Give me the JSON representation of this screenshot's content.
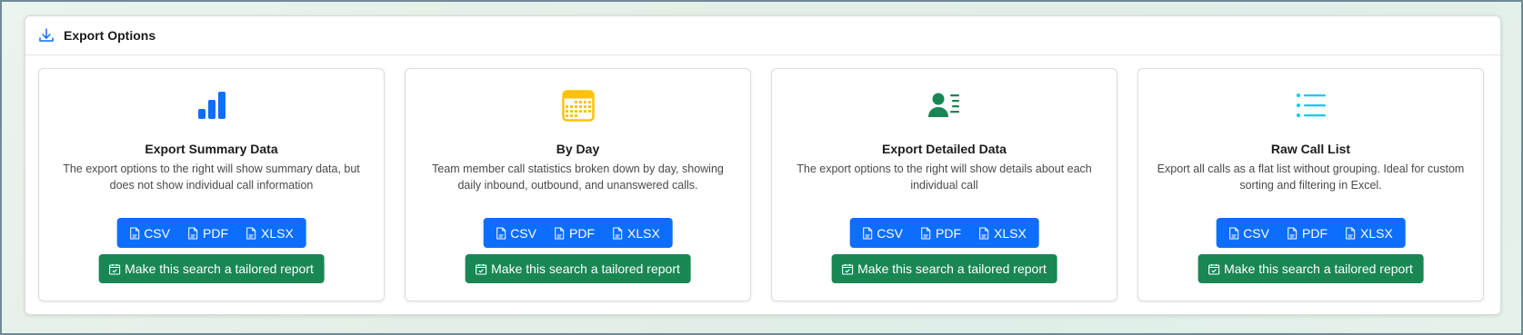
{
  "panel": {
    "title": "Export Options",
    "icon": "download-icon"
  },
  "cards": [
    {
      "icon": "bar-chart-icon",
      "icon_color": "#0d6efd",
      "title": "Export Summary Data",
      "description": "The export options to the right will show summary data, but does not show individual call information",
      "buttons": {
        "csv": "CSV",
        "pdf": "PDF",
        "xlsx": "XLSX"
      },
      "report_label": "Make this search a tailored report"
    },
    {
      "icon": "calendar-icon",
      "icon_color": "#ffc107",
      "title": "By Day",
      "description": "Team member call statistics broken down by day, showing daily inbound, outbound, and unanswered calls.",
      "buttons": {
        "csv": "CSV",
        "pdf": "PDF",
        "xlsx": "XLSX"
      },
      "report_label": "Make this search a tailored report"
    },
    {
      "icon": "person-lines-icon",
      "icon_color": "#198754",
      "title": "Export Detailed Data",
      "description": "The export options to the right will show details about each individual call",
      "buttons": {
        "csv": "CSV",
        "pdf": "PDF",
        "xlsx": "XLSX"
      },
      "report_label": "Make this search a tailored report"
    },
    {
      "icon": "list-icon",
      "icon_color": "#0dcaf0",
      "title": "Raw Call List",
      "description": "Export all calls as a flat list without grouping. Ideal for custom sorting and filtering in Excel.",
      "buttons": {
        "csv": "CSV",
        "pdf": "PDF",
        "xlsx": "XLSX"
      },
      "report_label": "Make this search a tailored report"
    }
  ],
  "colors": {
    "primary": "#0d6efd",
    "success": "#198754"
  }
}
